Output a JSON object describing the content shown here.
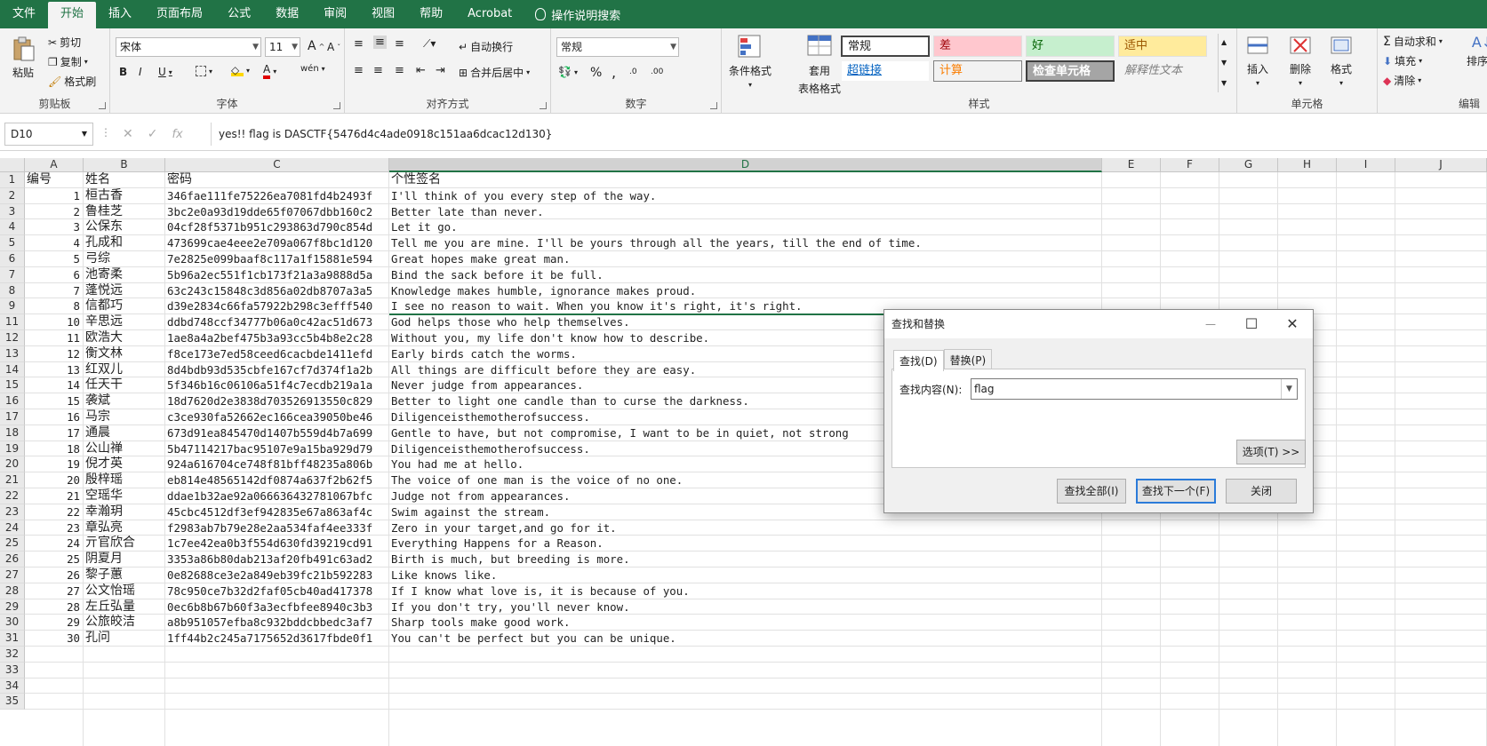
{
  "menu": [
    "文件",
    "开始",
    "插入",
    "页面布局",
    "公式",
    "数据",
    "审阅",
    "视图",
    "帮助",
    "Acrobat"
  ],
  "menu_active": "开始",
  "tell_me": "操作说明搜索",
  "ribbon": {
    "clipboard": {
      "paste": "粘贴",
      "cut": "剪切",
      "copy": "复制",
      "format_painter": "格式刷",
      "title": "剪贴板"
    },
    "font": {
      "name": "宋体",
      "size": "11",
      "bold": "B",
      "italic": "I",
      "underline": "U",
      "grow": "A",
      "shrink": "A",
      "title": "字体",
      "wen": "wén"
    },
    "align": {
      "wrap": "自动换行",
      "merge": "合并后居中",
      "title": "对齐方式"
    },
    "number": {
      "format": "常规",
      "percent": "%",
      "comma": ",",
      "title": "数字",
      "inc": ".0",
      "dec": ".00"
    },
    "styles": {
      "cond": "条件格式",
      "table": "套用",
      "table2": "表格格式",
      "normal": "常规",
      "bad": "差",
      "good": "好",
      "neutral": "适中",
      "hyperlink": "超链接",
      "calc": "计算",
      "check": "检查单元格",
      "explain": "解释性文本",
      "title": "样式"
    },
    "cells": {
      "insert": "插入",
      "delete": "删除",
      "format": "格式",
      "title": "单元格"
    },
    "editing": {
      "autosum": "自动求和",
      "fill": "填充",
      "clear": "清除",
      "sort": "排序和",
      "title": "编辑"
    }
  },
  "formula_bar": {
    "namebox": "D10",
    "cancel": "✕",
    "enter": "✓",
    "fx": "fx",
    "content": "yes!! flag is DASCTF{5476d4c4ade0918c151aa6dcac12d130}"
  },
  "columns": [
    "A",
    "B",
    "C",
    "D",
    "E",
    "F",
    "G",
    "H",
    "I",
    "J"
  ],
  "header_row": [
    "编号",
    "姓名",
    "密码",
    "个性签名"
  ],
  "rows": [
    {
      "r": "2",
      "id": "1",
      "name": "桓古香",
      "pw": "346fae111fe75226ea7081fd4b2493f",
      "sig": "I'll think of you every step of the way."
    },
    {
      "r": "3",
      "id": "2",
      "name": "鲁桂芝",
      "pw": "3bc2e0a93d19dde65f07067dbb160c2",
      "sig": "Better late than never."
    },
    {
      "r": "4",
      "id": "3",
      "name": "公保东",
      "pw": "04cf28f5371b951c293863d790c854d",
      "sig": "Let it go."
    },
    {
      "r": "5",
      "id": "4",
      "name": "孔成和",
      "pw": "473699cae4eee2e709a067f8bc1d120",
      "sig": "Tell me you are mine. I'll be yours through all the years, till the end of time."
    },
    {
      "r": "6",
      "id": "5",
      "name": "弓综",
      "pw": "7e2825e099baaf8c117a1f15881e594",
      "sig": "Great hopes make great man."
    },
    {
      "r": "7",
      "id": "6",
      "name": "池寄柔",
      "pw": "5b96a2ec551f1cb173f21a3a9888d5a",
      "sig": "Bind the sack before it be full."
    },
    {
      "r": "8",
      "id": "7",
      "name": "蓬悦远",
      "pw": "63c243c15848c3d856a02db8707a3a5",
      "sig": "Knowledge makes humble, ignorance makes proud."
    },
    {
      "r": "9",
      "id": "8",
      "name": "信都巧",
      "pw": "d39e2834c66fa57922b298c3efff540",
      "sig": "I see no reason to wait. When you know it's right, it's right."
    },
    {
      "r": "11",
      "id": "10",
      "name": "辛思远",
      "pw": "ddbd748ccf34777b06a0c42ac51d673",
      "sig": "God helps those who help themselves."
    },
    {
      "r": "12",
      "id": "11",
      "name": "欧浩大",
      "pw": "1ae8a4a2bef475b3a93cc5b4b8e2c28",
      "sig": "Without you, my life don't know how to describe."
    },
    {
      "r": "13",
      "id": "12",
      "name": "衡文林",
      "pw": "f8ce173e7ed58ceed6cacbde1411efd",
      "sig": "Early birds catch the worms."
    },
    {
      "r": "14",
      "id": "13",
      "name": "红双儿",
      "pw": "8d4bdb93d535cbfe167cf7d374f1a2b",
      "sig": "All things are difficult before they are easy."
    },
    {
      "r": "15",
      "id": "14",
      "name": "任天干",
      "pw": "5f346b16c06106a51f4c7ecdb219a1a",
      "sig": "Never judge from appearances."
    },
    {
      "r": "16",
      "id": "15",
      "name": "袭斌",
      "pw": "18d7620d2e3838d703526913550c829",
      "sig": "Better to light one candle than to curse the darkness."
    },
    {
      "r": "17",
      "id": "16",
      "name": "马宗",
      "pw": "c3ce930fa52662ec166cea39050be46",
      "sig": "Diligenceisthemotherofsuccess."
    },
    {
      "r": "18",
      "id": "17",
      "name": "通晨",
      "pw": "673d91ea845470d1407b559d4b7a699",
      "sig": "Gentle to have, but not compromise, I want to be in quiet, not strong"
    },
    {
      "r": "19",
      "id": "18",
      "name": "公山禅",
      "pw": "5b47114217bac95107e9a15ba929d79",
      "sig": "Diligenceisthemotherofsuccess."
    },
    {
      "r": "20",
      "id": "19",
      "name": "倪才英",
      "pw": "924a616704ce748f81bff48235a806b",
      "sig": "You had me at hello."
    },
    {
      "r": "21",
      "id": "20",
      "name": "殷梓瑶",
      "pw": "eb814e48565142df0874a637f2b62f5",
      "sig": "The voice of one man is the voice of no one."
    },
    {
      "r": "22",
      "id": "21",
      "name": "空瑶华",
      "pw": "ddae1b32ae92a066636432781067bfc",
      "sig": "Judge not from appearances."
    },
    {
      "r": "23",
      "id": "22",
      "name": "幸瀚玥",
      "pw": "45cbc4512df3ef942835e67a863af4c",
      "sig": "Swim against the stream."
    },
    {
      "r": "24",
      "id": "23",
      "name": "章弘亮",
      "pw": "f2983ab7b79e28e2aa534faf4ee333f",
      "sig": "Zero in your target,and go for it."
    },
    {
      "r": "25",
      "id": "24",
      "name": "亓官欣合",
      "pw": "1c7ee42ea0b3f554d630fd39219cd91",
      "sig": "Everything Happens for a Reason."
    },
    {
      "r": "26",
      "id": "25",
      "name": "阴夏月",
      "pw": "3353a86b80dab213af20fb491c63ad2",
      "sig": "Birth is much, but breeding is more."
    },
    {
      "r": "27",
      "id": "26",
      "name": "黎子蕙",
      "pw": "0e82688ce3e2a849eb39fc21b592283",
      "sig": "Like knows like."
    },
    {
      "r": "28",
      "id": "27",
      "name": "公文怡瑶",
      "pw": "78c950ce7b32d2faf05cb40ad417378",
      "sig": "If I know what love is, it is because of you."
    },
    {
      "r": "29",
      "id": "28",
      "name": "左丘弘量",
      "pw": "0ec6b8b67b60f3a3ecfbfee8940c3b3",
      "sig": "If you don't try, you'll never know."
    },
    {
      "r": "30",
      "id": "29",
      "name": "公旅皎洁",
      "pw": "a8b951057efba8c932bddcbbedc3af7",
      "sig": "Sharp tools make good work."
    },
    {
      "r": "31",
      "id": "30",
      "name": "孔问",
      "pw": "1ff44b2c245a7175652d3617fbde0f1",
      "sig": "You can't be perfect but you can be unique."
    }
  ],
  "empty_rows": [
    "32",
    "33",
    "34",
    "35"
  ],
  "dialog": {
    "title": "查找和替换",
    "tab_find": "查找(D)",
    "tab_replace": "替换(P)",
    "find_label": "查找内容(N):",
    "find_value": "flag",
    "options": "选项(T) >>",
    "find_all": "查找全部(I)",
    "find_next": "查找下一个(F)",
    "close": "关闭",
    "minimize": "—",
    "maximize": "☐",
    "close_x": "✕"
  },
  "colors": {
    "excel_green": "#217346",
    "bad_bg": "#ffc7ce",
    "good_bg": "#c6efce",
    "neutral_bg": "#ffeb9c"
  }
}
